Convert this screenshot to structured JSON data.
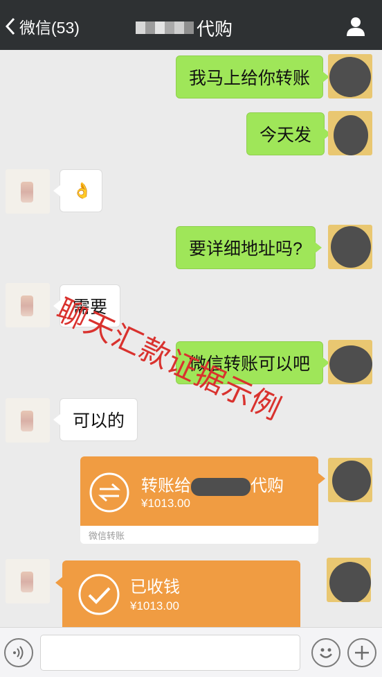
{
  "header": {
    "back_label": "微信(53)",
    "title": "代购"
  },
  "messages": [
    {
      "side": "me",
      "text": "我马上给你转账"
    },
    {
      "side": "me",
      "text": "今天发"
    },
    {
      "side": "them",
      "text": "👌"
    },
    {
      "side": "me",
      "text": "要详细地址吗?"
    },
    {
      "side": "them",
      "text": "需要"
    },
    {
      "side": "me",
      "text": "微信转账可以吧"
    },
    {
      "side": "them",
      "text": "可以的"
    }
  ],
  "transfer": {
    "title_prefix": "转账给",
    "title_suffix": "代购",
    "amount": "¥1013.00",
    "footer": "微信转账"
  },
  "received": {
    "title": "已收钱",
    "amount": "¥1013.00"
  },
  "watermark": "聊天汇款证据示例",
  "colors": {
    "topbar": "#2e3133",
    "bubble_me": "#9fe659",
    "transfer_orange": "#f09c42",
    "watermark_red": "#d9322e"
  },
  "icons": {
    "back": "chevron-left-icon",
    "profile": "person-icon",
    "voice": "voice-icon",
    "emoji": "smile-icon",
    "more": "plus-icon",
    "transfer": "transfer-arrows-icon",
    "received": "check-circle-icon"
  }
}
